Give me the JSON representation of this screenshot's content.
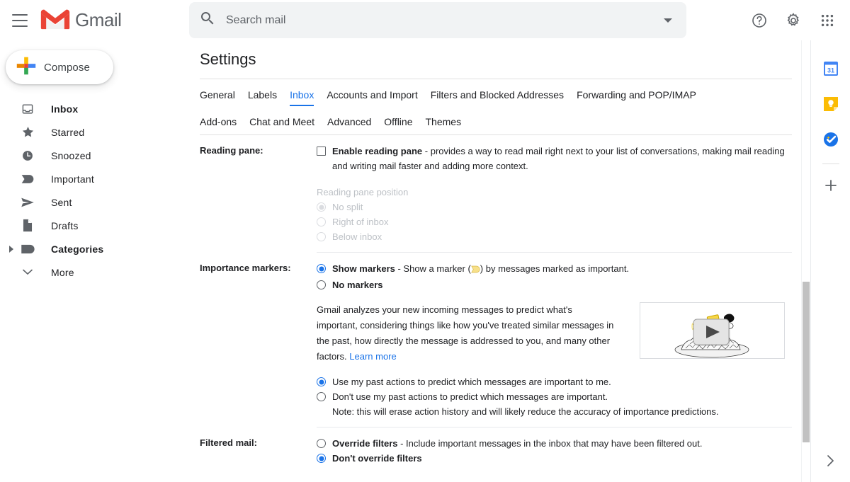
{
  "header": {
    "menu_icon": "hamburger-menu-icon",
    "logo_icon": "gmail-logo-icon",
    "brand": "Gmail",
    "search": {
      "icon": "search-icon",
      "placeholder": "Search mail",
      "value": "",
      "options_icon": "chevron-down-icon"
    },
    "help_icon": "help-circle-icon",
    "settings_icon": "gear-icon",
    "apps_icon": "google-apps-grid-icon"
  },
  "sidebar": {
    "compose": {
      "label": "Compose",
      "icon": "plus-icon"
    },
    "items": [
      {
        "label": "Inbox",
        "icon": "inbox-icon",
        "bold": true,
        "arrow": ""
      },
      {
        "label": "Starred",
        "icon": "star-icon",
        "bold": false,
        "arrow": ""
      },
      {
        "label": "Snoozed",
        "icon": "clock-icon",
        "bold": false,
        "arrow": ""
      },
      {
        "label": "Important",
        "icon": "important-marker-icon",
        "bold": false,
        "arrow": ""
      },
      {
        "label": "Sent",
        "icon": "send-icon",
        "bold": false,
        "arrow": ""
      },
      {
        "label": "Drafts",
        "icon": "draft-file-icon",
        "bold": false,
        "arrow": ""
      },
      {
        "label": "Categories",
        "icon": "label-tag-icon",
        "bold": true,
        "arrow": "chevron-right-icon"
      },
      {
        "label": "More",
        "icon": "",
        "bold": false,
        "arrow": "chevron-down-icon"
      }
    ]
  },
  "main": {
    "title": "Settings",
    "tabs_row1": [
      {
        "label": "General",
        "active": false
      },
      {
        "label": "Labels",
        "active": false
      },
      {
        "label": "Inbox",
        "active": true
      },
      {
        "label": "Accounts and Import",
        "active": false
      },
      {
        "label": "Filters and Blocked Addresses",
        "active": false
      },
      {
        "label": "Forwarding and POP/IMAP",
        "active": false
      }
    ],
    "tabs_row2": [
      {
        "label": "Add-ons",
        "active": false
      },
      {
        "label": "Chat and Meet",
        "active": false
      },
      {
        "label": "Advanced",
        "active": false
      },
      {
        "label": "Offline",
        "active": false
      },
      {
        "label": "Themes",
        "active": false
      }
    ],
    "reading_pane": {
      "row_label": "Reading pane:",
      "enable_label": "Enable reading pane",
      "enable_desc": " - provides a way to read mail right next to your list of conversations, making mail reading and writing mail faster and adding more context.",
      "enable_checked": false,
      "position_label": "Reading pane position",
      "position_options": [
        {
          "label": "No split",
          "checked": true,
          "disabled": true
        },
        {
          "label": "Right of inbox",
          "checked": false,
          "disabled": true
        },
        {
          "label": "Below inbox",
          "checked": false,
          "disabled": true
        }
      ]
    },
    "importance_markers": {
      "row_label": "Importance markers:",
      "show_label": "Show markers",
      "show_desc_pre": " - Show a marker (",
      "show_desc_post": ") by messages marked as important.",
      "show_checked": true,
      "none_label": "No markers",
      "none_checked": false,
      "explanation": "Gmail analyzes your new incoming messages to predict what's important, considering things like how you've treated similar messages in the past, how directly the message is addressed to you, and many other factors. ",
      "learn_more": "Learn more",
      "video_thumb_icon": "play-button-video-thumbnail",
      "past_actions": [
        {
          "label": "Use my past actions to predict which messages are important to me.",
          "checked": true
        },
        {
          "label": "Don't use my past actions to predict which messages are important.",
          "checked": false
        }
      ],
      "past_actions_note": "Note: this will erase action history and will likely reduce the accuracy of importance predictions."
    },
    "filtered_mail": {
      "row_label": "Filtered mail:",
      "override_label": "Override filters",
      "override_desc": " - Include important messages in the inbox that may have been filtered out.",
      "override_checked": false,
      "dont_override_label": "Don't override filters",
      "dont_override_checked": true
    }
  },
  "right_rail": {
    "items": [
      {
        "icon": "google-calendar-icon",
        "label": "31"
      },
      {
        "icon": "google-keep-icon",
        "label": ""
      },
      {
        "icon": "google-tasks-icon",
        "label": ""
      }
    ],
    "add_icon": "plus-icon",
    "expand_icon": "chevron-right-icon"
  },
  "colors": {
    "accent": "#1a73e8",
    "text": "#202124",
    "muted": "#5f6368",
    "disabled": "#bdc1c6",
    "marker_yellow": "#f2c94c",
    "gmail_red": "#ea4335"
  }
}
